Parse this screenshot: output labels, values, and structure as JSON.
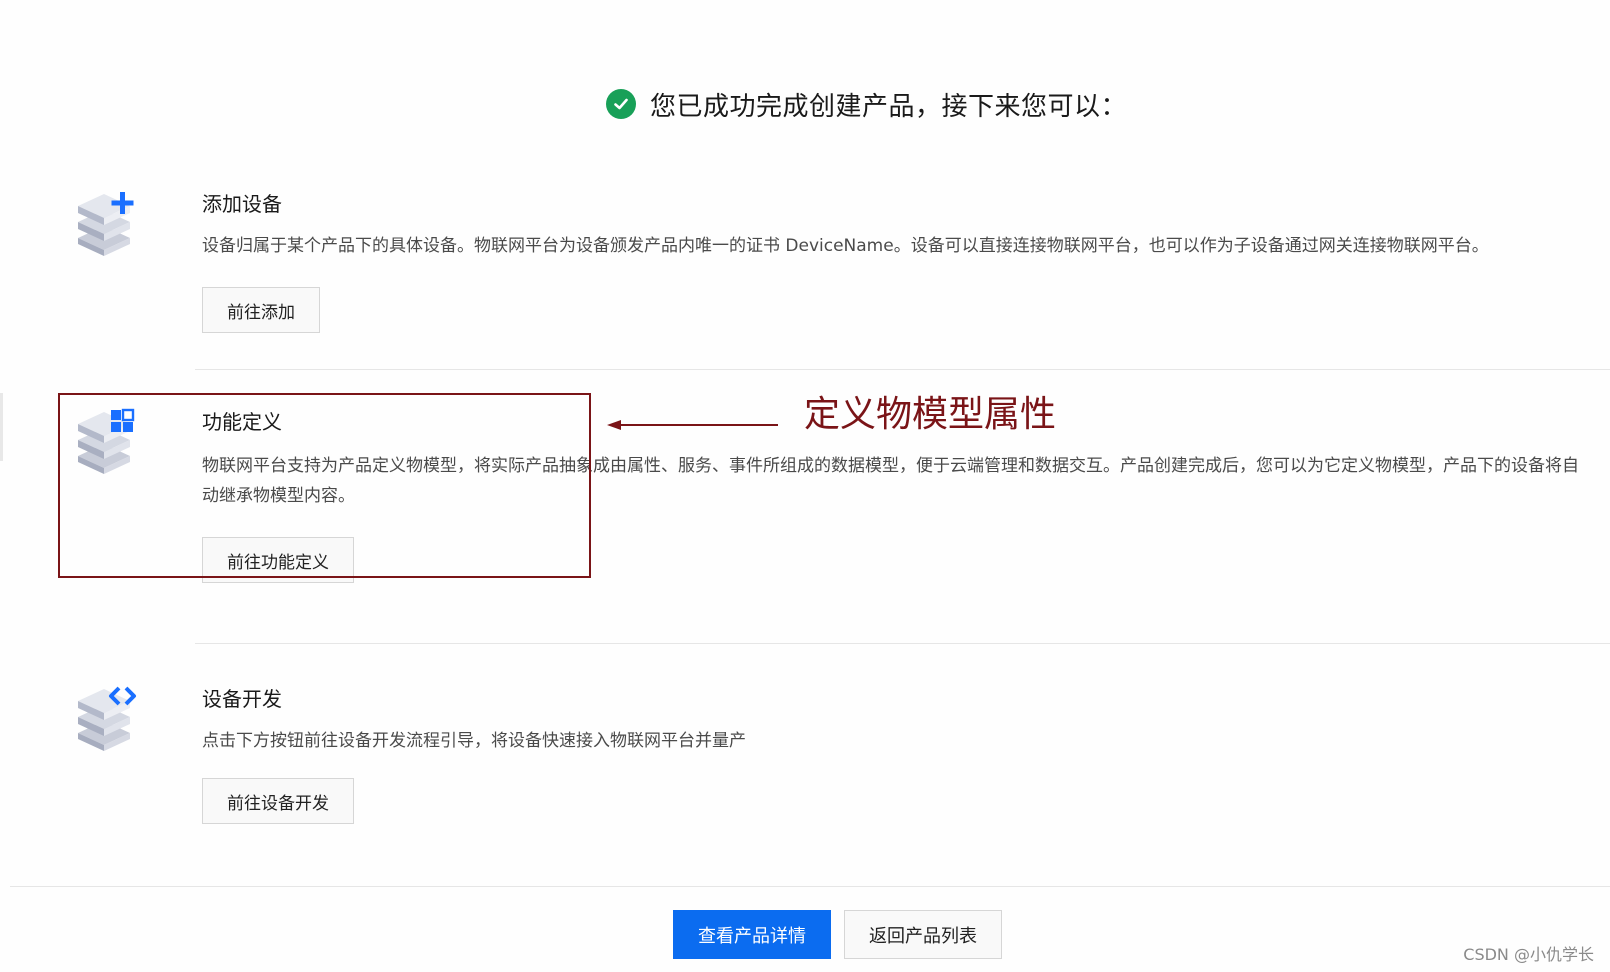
{
  "header": {
    "title": "您已成功完成创建产品，接下来您可以："
  },
  "sections": [
    {
      "title": "添加设备",
      "description": "设备归属于某个产品下的具体设备。物联网平台为设备颁发产品内唯一的证书 DeviceName。设备可以直接连接物联网平台，也可以作为子设备通过网关连接物联网平台。",
      "button_label": "前往添加",
      "icon": "add-device-icon"
    },
    {
      "title": "功能定义",
      "description": "物联网平台支持为产品定义物模型，将实际产品抽象成由属性、服务、事件所组成的数据模型，便于云端管理和数据交互。产品创建完成后，您可以为它定义物模型，产品下的设备将自动继承物模型内容。",
      "button_label": "前往功能定义",
      "icon": "function-definition-icon"
    },
    {
      "title": "设备开发",
      "description": "点击下方按钮前往设备开发流程引导，将设备快速接入物联网平台并量产",
      "button_label": "前往设备开发",
      "icon": "device-development-icon"
    }
  ],
  "annotation": {
    "label": "定义物模型属性",
    "color": "#7a1417"
  },
  "footer": {
    "primary_label": "查看产品详情",
    "secondary_label": "返回产品列表"
  },
  "watermark": "CSDN @小仇学长",
  "colors": {
    "primary": "#0b6cf0",
    "success": "#18a058",
    "icon_blue": "#1a6fff"
  }
}
